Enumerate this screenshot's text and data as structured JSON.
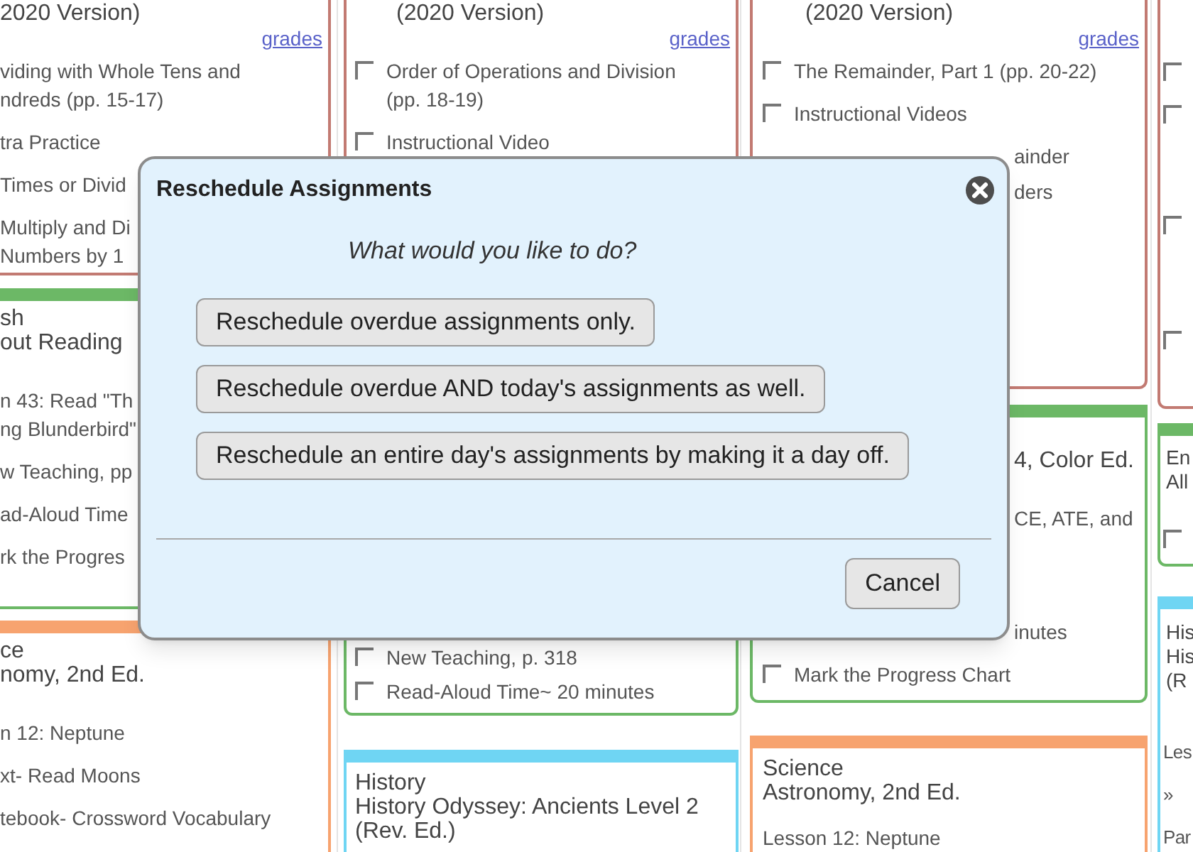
{
  "columns": [
    {
      "cards": [
        {
          "color": "#c27a72",
          "heading": [
            "2020 Version)"
          ],
          "grades": "grades",
          "items": [
            {
              "kind": "plain",
              "lines": [
                "viding with Whole Tens and",
                "ndreds (pp. 15-17)"
              ]
            },
            {
              "kind": "plain",
              "lines": [
                "tra Practice"
              ]
            },
            {
              "kind": "plain",
              "lines": [
                "Times or Divid"
              ]
            },
            {
              "kind": "plain",
              "lines": [
                "Multiply and Di",
                "Numbers by 1"
              ]
            }
          ]
        },
        {
          "color": "#6cb866",
          "heading": [
            "sh",
            "out Reading"
          ],
          "items": [
            {
              "kind": "plain",
              "lines": [
                "n 43: Read \"Th",
                "ng Blunderbird\""
              ]
            },
            {
              "kind": "plain",
              "lines": [
                "w Teaching, pp"
              ]
            },
            {
              "kind": "plain",
              "lines": [
                "ad-Aloud Time"
              ]
            },
            {
              "kind": "plain",
              "lines": [
                "rk the Progres"
              ]
            }
          ]
        },
        {
          "color": "#f7a36f",
          "heading": [
            "ce",
            "nomy, 2nd Ed."
          ],
          "items": [
            {
              "kind": "plain",
              "lines": [
                "n 12: Neptune"
              ]
            },
            {
              "kind": "plain",
              "lines": [
                "xt- Read Moons"
              ]
            },
            {
              "kind": "plain",
              "lines": [
                "tebook- Crossword Vocabulary"
              ]
            }
          ]
        }
      ]
    },
    {
      "cards": [
        {
          "color": "#c27a72",
          "heading": [
            "(2020 Version)"
          ],
          "grades": "grades",
          "items": [
            {
              "kind": "checkbox",
              "checked": false,
              "lines": [
                "Order of Operations and Division",
                "(pp. 18-19)"
              ]
            },
            {
              "kind": "checkbox",
              "checked": false,
              "lines": [
                "Instructional Video"
              ]
            }
          ]
        },
        {
          "color": "#6cb866",
          "items": [
            {
              "kind": "checkbox",
              "checked": false,
              "lines": [
                "New Teaching, p. 318"
              ]
            },
            {
              "kind": "checkbox",
              "checked": false,
              "lines": [
                "Read-Aloud Time~ 20 minutes"
              ]
            }
          ]
        },
        {
          "color": "#6fd5f3",
          "heading": [
            "History",
            "History Odyssey: Ancients Level 2",
            "(Rev. Ed.)"
          ]
        }
      ]
    },
    {
      "cards": [
        {
          "color": "#c27a72",
          "heading": [
            "(2020 Version)"
          ],
          "grades": "grades",
          "items": [
            {
              "kind": "checkbox",
              "checked": false,
              "lines": [
                "The Remainder, Part 1 (pp. 20-22)"
              ]
            },
            {
              "kind": "checkbox",
              "checked": false,
              "lines": [
                "Instructional Videos"
              ]
            },
            {
              "kind": "fragment",
              "lines": [
                "ainder"
              ]
            },
            {
              "kind": "fragment",
              "lines": [
                "ders"
              ]
            }
          ]
        },
        {
          "color": "#6cb866",
          "heading": [
            "4, Color Ed."
          ],
          "items": [
            {
              "kind": "fragment",
              "lines": [
                "CE, ATE, and"
              ]
            },
            {
              "kind": "fragment",
              "lines": [
                "inutes"
              ]
            },
            {
              "kind": "checkbox",
              "checked": false,
              "lines": [
                "Mark the Progress Chart"
              ]
            }
          ]
        },
        {
          "color": "#f7a36f",
          "heading": [
            "Science",
            "Astronomy, 2nd Ed."
          ],
          "items": [
            {
              "kind": "plain",
              "lines": [
                "Lesson 12: Neptune"
              ]
            }
          ]
        }
      ]
    },
    {
      "cards": [
        {
          "color": "#c27a72",
          "items": [
            {
              "kind": "checkbox",
              "checked": false
            },
            {
              "kind": "checkbox",
              "checked": false
            },
            {
              "kind": "checkbox",
              "checked": false
            },
            {
              "kind": "checkbox",
              "checked": false
            }
          ]
        },
        {
          "color": "#6cb866",
          "heading": [
            "En",
            "All"
          ],
          "items": [
            {
              "kind": "checkbox",
              "checked": false
            }
          ]
        },
        {
          "color": "#6fd5f3",
          "heading": [
            "His",
            "His",
            "(R"
          ],
          "items": [
            {
              "kind": "plain",
              "lines": [
                "Les"
              ]
            },
            {
              "kind": "plain",
              "lines": [
                "»"
              ]
            },
            {
              "kind": "plain",
              "lines": [
                "Par"
              ]
            }
          ]
        }
      ]
    }
  ],
  "dialog": {
    "title": "Reschedule Assignments",
    "question": "What would you like to do?",
    "options": [
      "Reschedule overdue assignments only.",
      "Reschedule overdue AND today's assignments as well.",
      "Reschedule an entire day's assignments by making it a day off."
    ],
    "cancel": "Cancel"
  }
}
